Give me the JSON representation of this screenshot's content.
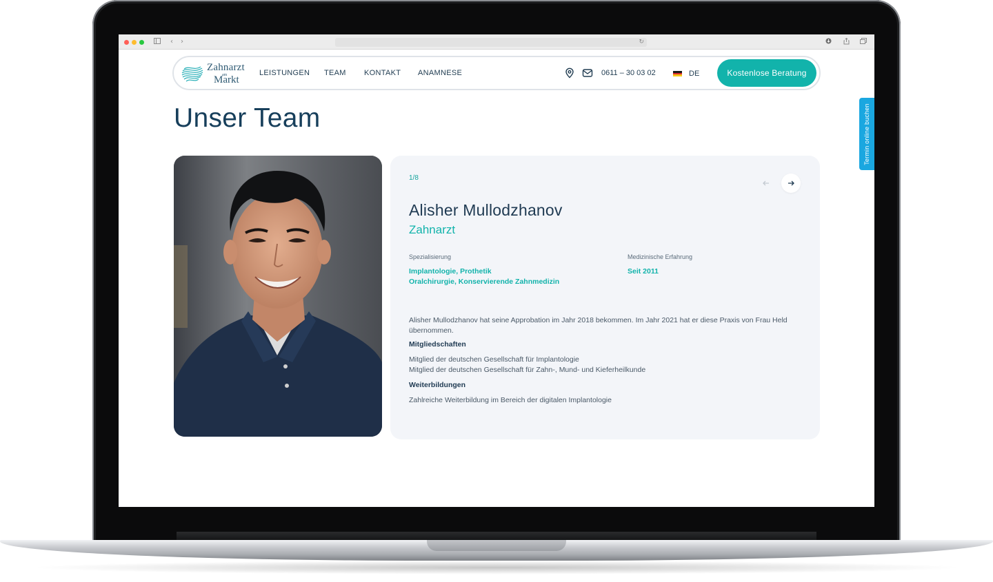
{
  "header": {
    "logo": {
      "line1": "Zahnarzt",
      "small": "am",
      "line2": "Markt"
    },
    "nav": [
      "LEISTUNGEN",
      "TEAM",
      "KONTAKT",
      "ANAMNESE"
    ],
    "phone": "0611 – 30 03 02",
    "language": "DE",
    "cta_label": "Kostenlose Beratung",
    "icons": {
      "location": "location-pin-icon",
      "mail": "mail-icon",
      "flag": "germany-flag-icon"
    }
  },
  "side_tab": {
    "label": "Termin online buchen"
  },
  "main": {
    "title": "Unser Team",
    "photo_alt": "Portrait of Alisher Mullodzhanov",
    "card": {
      "pager": "1/8",
      "name": "Alisher Mullodzhanov",
      "role": "Zahnarzt",
      "specialization_label": "Spezialisierung",
      "specialization": [
        "Implantologie, Prothetik",
        "Oralchirurgie, Konservierende Zahnmedizin"
      ],
      "experience_label": "Medizinische Erfahrung",
      "experience": "Seit 2011",
      "bio": "Alisher Mullodzhanov hat seine Approbation im Jahr 2018 bekommen. Im Jahr 2021 hat er diese Praxis von Frau Held übernommen.",
      "memberships_title": "Mitgliedschaften",
      "memberships": [
        "Mitglied der deutschen Gesellschaft für Implantologie",
        "Mitglied der deutschen Gesellschaft für Zahn-, Mund- und Kieferheilkunde"
      ],
      "training_title": "Weiterbildungen",
      "training": [
        "Zahlreiche Weiterbildung im Bereich der digitalen Implantologie"
      ]
    }
  },
  "colors": {
    "accent": "#12b3ab",
    "heading": "#173f5b",
    "card_bg": "#f3f5f9",
    "side_tab": "#1aa7e0"
  }
}
